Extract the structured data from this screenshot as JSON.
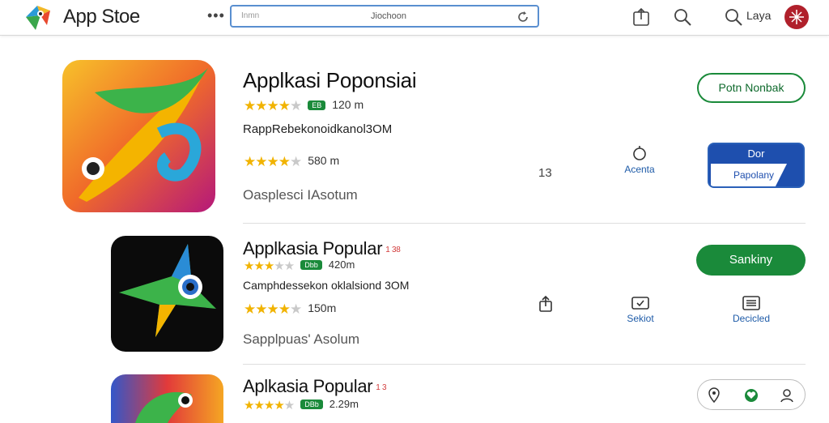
{
  "header": {
    "brand": "App Stoe",
    "search_placeholder": "Inmn",
    "search_value": "Jiochoon",
    "user_label": "Laya"
  },
  "apps": [
    {
      "title": "Applkasi Poponsiai",
      "rating_meta": "120 m",
      "badge": "EB",
      "line1": "RappRebekonoidkanol3OM",
      "rating2_meta": "580 m",
      "line2": "Oasplesci IAsotum",
      "count": "13",
      "action_label": "Acenta",
      "button_label": "Potn Nonbak",
      "button2_top": "Dor",
      "button2_bottom": "Papolany"
    },
    {
      "title": "Applkasia Popular",
      "title_tag": "1 38",
      "badge": "Dbb",
      "rating_meta": "420m",
      "line1": "Camphdessekon oklalsiond 3OM",
      "rating2_meta": "150m",
      "line2": "Sapplpuas' Asolum",
      "action1_label": "Sekiot",
      "action2_label": "Decicled",
      "button_label": "Sankiny"
    },
    {
      "title": "Aplkasia Popular",
      "title_tag": "1 3",
      "badge": "DBb",
      "rating_meta": "2.29m"
    }
  ],
  "colors": {
    "accent_green": "#1a8a3a",
    "accent_blue": "#1e4fae",
    "star": "#f1b300"
  },
  "icons": [
    "app-store-logo-icon",
    "more-dots-icon",
    "refresh-icon",
    "share-icon",
    "search-icon",
    "user-avatar-icon",
    "info-icon",
    "heart-icon",
    "profile-icon"
  ]
}
